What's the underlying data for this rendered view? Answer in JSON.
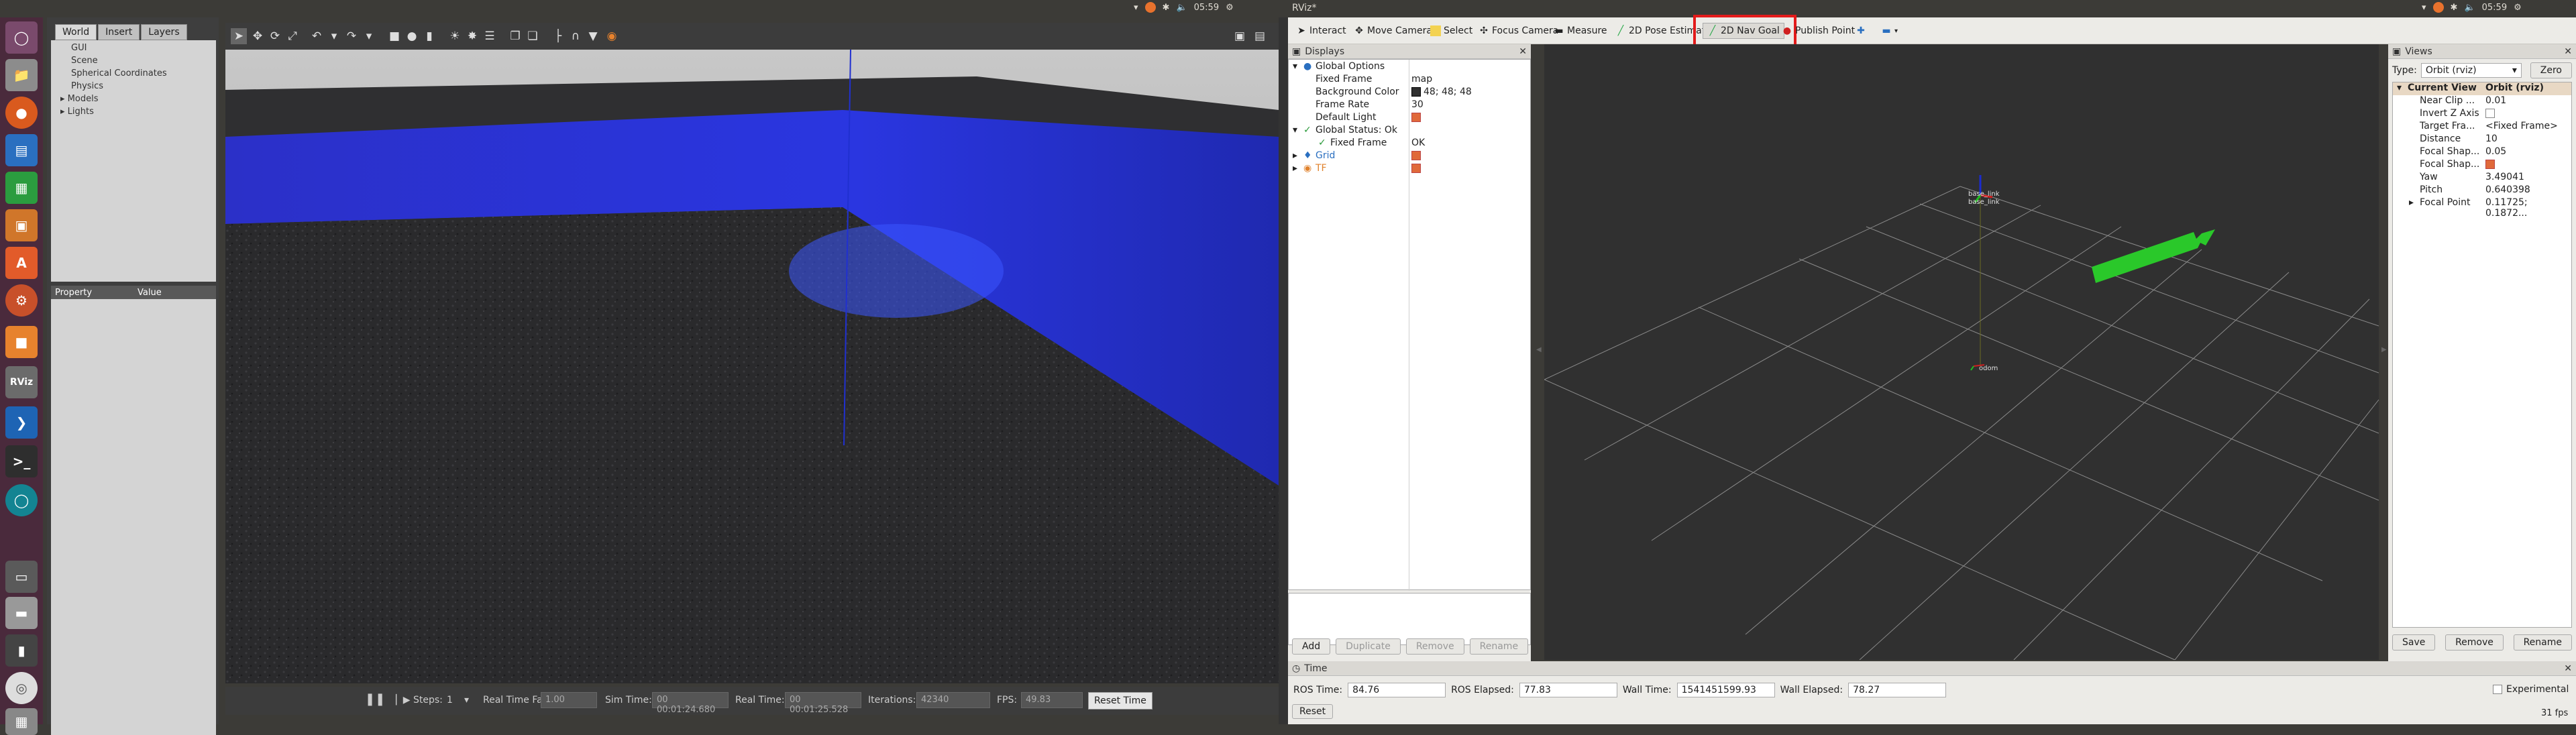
{
  "system_bar": {
    "left_title": "",
    "right_title": "RViz*",
    "clock_left": "05:59",
    "clock_right": "05:59"
  },
  "launcher": {
    "items": [
      "ubuntu-dash-icon",
      "files-icon",
      "firefox-icon",
      "writer-icon",
      "calc-icon",
      "impress-icon",
      "software-center-icon",
      "settings-icon",
      "gazebo-icon",
      "rviz-icon",
      "vscode-icon",
      "terminal-icon",
      "orb-icon",
      "files-drive-icon",
      "drive-icon",
      "media-icon",
      "dvd-icon",
      "trash-icon"
    ],
    "rviz_label": "RViz"
  },
  "gazebo": {
    "tabs": [
      "World",
      "Insert",
      "Layers"
    ],
    "tree": [
      "GUI",
      "Scene",
      "Spherical Coordinates",
      "Physics",
      "Models",
      "Lights"
    ],
    "property_headers": [
      "Property",
      "Value"
    ],
    "bottom": {
      "steps_label": "Steps:",
      "steps_value": "1",
      "rtf_label": "Real Time Factor:",
      "rtf_value": "1.00",
      "sim_label": "Sim Time:",
      "sim_value": "00 00:01:24.680",
      "real_label": "Real Time:",
      "real_value": "00 00:01:25.528",
      "iter_label": "Iterations:",
      "iter_value": "42340",
      "fps_label": "FPS:",
      "fps_value": "49.83",
      "reset_label": "Reset Time"
    }
  },
  "rviz": {
    "toolbar": {
      "interact": "Interact",
      "move_camera": "Move Camera",
      "select": "Select",
      "focus_camera": "Focus Camera",
      "measure": "Measure",
      "pose_estimate": "2D Pose Estimat",
      "nav_goal": "2D Nav Goal",
      "publish_point": "Publish Point"
    },
    "displays": {
      "title": "Displays",
      "rows": [
        {
          "key": "Global Options",
          "value": ""
        },
        {
          "key": "Fixed Frame",
          "value": "map"
        },
        {
          "key": "Background Color",
          "value": "48; 48; 48"
        },
        {
          "key": "Frame Rate",
          "value": "30"
        },
        {
          "key": "Default Light",
          "value": ""
        },
        {
          "key": "Global Status: Ok",
          "value": ""
        },
        {
          "key": "Fixed Frame",
          "value": "OK"
        },
        {
          "key": "Grid",
          "value": ""
        },
        {
          "key": "TF",
          "value": ""
        }
      ],
      "buttons": [
        "Add",
        "Duplicate",
        "Remove",
        "Rename"
      ]
    },
    "views": {
      "title": "Views",
      "type_label": "Type:",
      "type_value": "Orbit (rviz)",
      "zero_label": "Zero",
      "rows": [
        {
          "key": "Current View",
          "value": "Orbit (rviz)"
        },
        {
          "key": "Near Clip ...",
          "value": "0.01"
        },
        {
          "key": "Invert Z Axis",
          "value": ""
        },
        {
          "key": "Target Fra...",
          "value": "<Fixed Frame>"
        },
        {
          "key": "Distance",
          "value": "10"
        },
        {
          "key": "Focal Shap...",
          "value": "0.05"
        },
        {
          "key": "Focal Shap...",
          "value": ""
        },
        {
          "key": "Yaw",
          "value": "3.49041"
        },
        {
          "key": "Pitch",
          "value": "0.640398"
        },
        {
          "key": "Focal Point",
          "value": "0.11725; 0.1872..."
        }
      ],
      "buttons": [
        "Save",
        "Remove",
        "Rename"
      ]
    },
    "time": {
      "title": "Time",
      "ros_time_label": "ROS Time:",
      "ros_time": "84.76",
      "ros_elapsed_label": "ROS Elapsed:",
      "ros_elapsed": "77.83",
      "wall_time_label": "Wall Time:",
      "wall_time": "1541451599.93",
      "wall_elapsed_label": "Wall Elapsed:",
      "wall_elapsed": "78.27",
      "experimental_label": "Experimental",
      "reset_label": "Reset",
      "fps": "31 fps"
    },
    "scene_labels": {
      "robot_1": "base_link",
      "robot_2": "base_link",
      "odom": "odom"
    }
  }
}
